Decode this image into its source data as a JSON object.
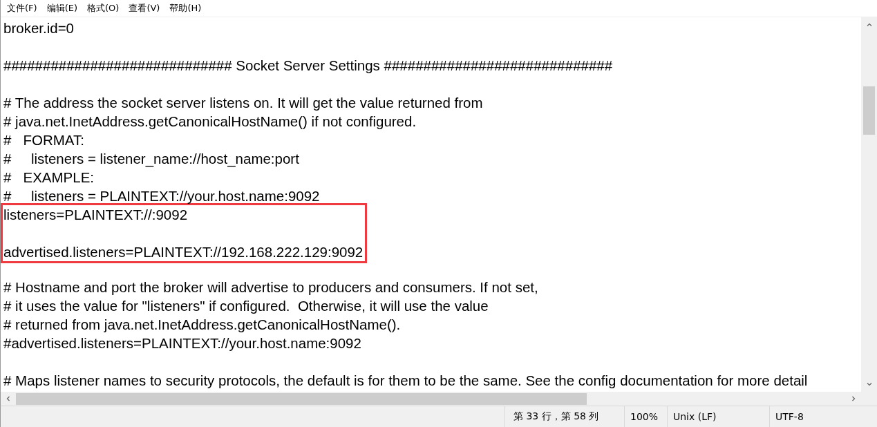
{
  "menu": [
    {
      "label": "文件(F)"
    },
    {
      "label": "编辑(E)"
    },
    {
      "label": "格式(O)"
    },
    {
      "label": "查看(V)"
    },
    {
      "label": "帮助(H)"
    }
  ],
  "editor": {
    "blocks": [
      {
        "kind": "plain",
        "paragraphs": [
          [
            "broker.id=0"
          ],
          [
            "############################# Socket Server Settings #############################"
          ],
          [
            "# The address the socket server listens on. It will get the value returned from",
            "# java.net.InetAddress.getCanonicalHostName() if not configured.",
            "#   FORMAT:",
            "#     listeners = listener_name://host_name:port",
            "#   EXAMPLE:",
            "#     listeners = PLAINTEXT://your.host.name:9092"
          ]
        ]
      },
      {
        "kind": "boxed",
        "paragraphs": [
          [
            "listeners=PLAINTEXT://:9092"
          ],
          [
            "advertised.listeners=PLAINTEXT://192.168.222.129:9092"
          ]
        ]
      },
      {
        "kind": "plain",
        "paragraphs": [
          [
            "# Hostname and port the broker will advertise to producers and consumers. If not set,",
            "# it uses the value for \"listeners\" if configured.  Otherwise, it will use the value",
            "# returned from java.net.InetAddress.getCanonicalHostName().",
            "#advertised.listeners=PLAINTEXT://your.host.name:9092"
          ],
          [
            "# Maps listener names to security protocols, the default is for them to be the same. See the config documentation for more detail"
          ]
        ]
      }
    ]
  },
  "status_bar": {
    "cells": [
      "第 33 行，第 58 列",
      "100%",
      "Unix (LF)",
      "UTF-8"
    ]
  }
}
